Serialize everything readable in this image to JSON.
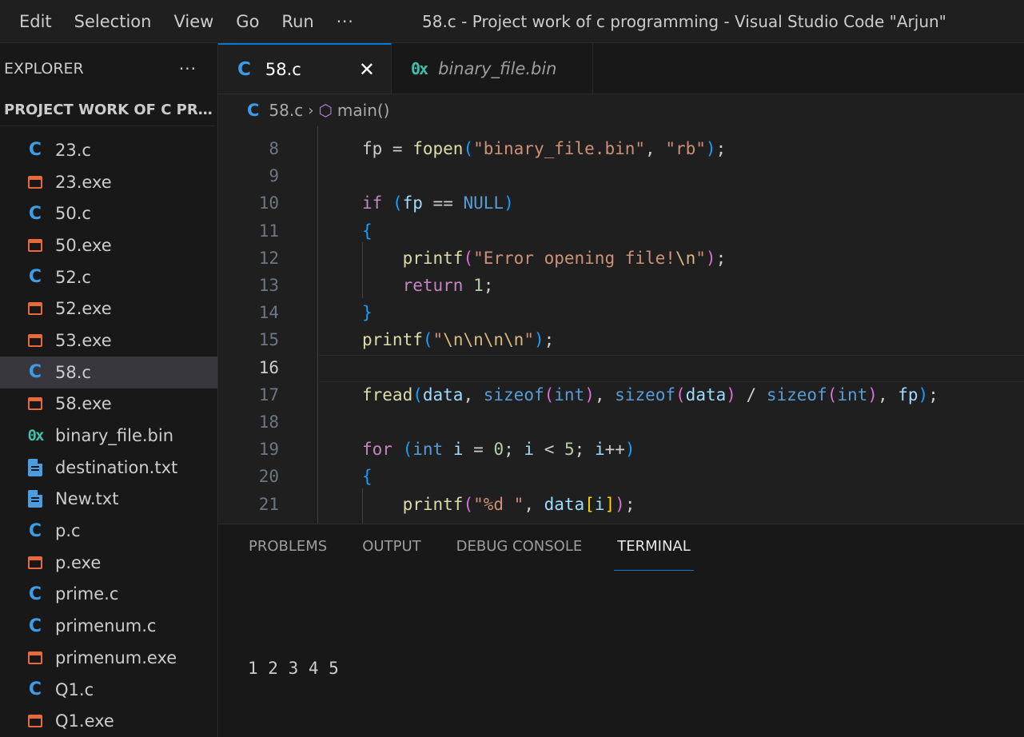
{
  "titlebar": {
    "menu": [
      "Edit",
      "Selection",
      "View",
      "Go",
      "Run"
    ],
    "more": "···",
    "window_title": "58.c - Project work of c programming - Visual Studio Code \"Arjun\""
  },
  "sidebar": {
    "header": "EXPLORER",
    "more": "···",
    "project": "PROJECT WORK OF C PRO...",
    "files": [
      {
        "name": "23.c",
        "type": "c"
      },
      {
        "name": "23.exe",
        "type": "exe"
      },
      {
        "name": "50.c",
        "type": "c"
      },
      {
        "name": "50.exe",
        "type": "exe"
      },
      {
        "name": "52.c",
        "type": "c"
      },
      {
        "name": "52.exe",
        "type": "exe"
      },
      {
        "name": "53.exe",
        "type": "exe"
      },
      {
        "name": "58.c",
        "type": "c",
        "active": true
      },
      {
        "name": "58.exe",
        "type": "exe"
      },
      {
        "name": "binary_file.bin",
        "type": "bin"
      },
      {
        "name": "destination.txt",
        "type": "txt"
      },
      {
        "name": "New.txt",
        "type": "txt"
      },
      {
        "name": "p.c",
        "type": "c"
      },
      {
        "name": "p.exe",
        "type": "exe"
      },
      {
        "name": "prime.c",
        "type": "c"
      },
      {
        "name": "primenum.c",
        "type": "c"
      },
      {
        "name": "primenum.exe",
        "type": "exe"
      },
      {
        "name": "Q1.c",
        "type": "c"
      },
      {
        "name": "Q1.exe",
        "type": "exe"
      }
    ]
  },
  "tabs": [
    {
      "label": "58.c",
      "active": true
    },
    {
      "label": "binary_file.bin",
      "active": false
    }
  ],
  "breadcrumb": {
    "file": "58.c",
    "symbol": "main()"
  },
  "editor": {
    "current_line": "16",
    "lines": [
      {
        "n": "8",
        "html": "fp = <span class='f'>fopen</span><span class='p2'>(</span><span class='s'>\"binary_file.bin\"</span>, <span class='s'>\"rb\"</span><span class='p2'>)</span>;"
      },
      {
        "n": "9",
        "html": ""
      },
      {
        "n": "10",
        "html": "<span class='k'>if</span> <span class='p2'>(</span><span class='v'>fp</span> == <span class='t'>NULL</span><span class='p2'>)</span>"
      },
      {
        "n": "11",
        "html": "<span class='p2'>{</span>"
      },
      {
        "n": "12",
        "html": "    <span class='f'>printf</span><span class='p1'>(</span><span class='s'>\"Error opening file!</span><span class='esc'>\\n</span><span class='s'>\"</span><span class='p1'>)</span>;"
      },
      {
        "n": "13",
        "html": "    <span class='k'>return</span> <span class='n'>1</span>;"
      },
      {
        "n": "14",
        "html": "<span class='p2'>}</span>"
      },
      {
        "n": "15",
        "html": "<span class='f'>printf</span><span class='p2'>(</span><span class='s'>\"</span><span class='esc'>\\n\\n\\n\\n</span><span class='s'>\"</span><span class='p2'>)</span>;"
      },
      {
        "n": "16",
        "html": ""
      },
      {
        "n": "17",
        "html": "<span class='f'>fread</span><span class='p2'>(</span><span class='v'>data</span>, <span class='t'>sizeof</span><span class='p1'>(</span><span class='t'>int</span><span class='p1'>)</span>, <span class='t'>sizeof</span><span class='p1'>(</span><span class='v'>data</span><span class='p1'>)</span> / <span class='t'>sizeof</span><span class='p1'>(</span><span class='t'>int</span><span class='p1'>)</span>, <span class='v'>fp</span><span class='p2'>)</span>;"
      },
      {
        "n": "18",
        "html": ""
      },
      {
        "n": "19",
        "html": "<span class='k'>for</span> <span class='p2'>(</span><span class='t'>int</span> <span class='v'>i</span> = <span class='n'>0</span>; <span class='v'>i</span> &lt; <span class='n'>5</span>; <span class='v'>i</span>++<span class='p2'>)</span>"
      },
      {
        "n": "20",
        "html": "<span class='p2'>{</span>"
      },
      {
        "n": "21",
        "html": "    <span class='f'>printf</span><span class='p1'>(</span><span class='s'>\"%d \"</span>, <span class='v'>data</span><span class='p3'>[</span><span class='v'>i</span><span class='p3'>]</span><span class='p1'>)</span>;"
      }
    ]
  },
  "panel": {
    "tabs": [
      {
        "label": "PROBLEMS",
        "active": false
      },
      {
        "label": "OUTPUT",
        "active": false
      },
      {
        "label": "DEBUG CONSOLE",
        "active": false
      },
      {
        "label": "TERMINAL",
        "active": true
      }
    ],
    "terminal_output": "1 2 3 4 5"
  },
  "colors": {
    "accent": "#0078d4",
    "c_icon": "#3c9ce8",
    "exe_icon": "#e8693a",
    "bin_icon": "#3fbfa8",
    "txt_icon": "#4a9de0"
  }
}
